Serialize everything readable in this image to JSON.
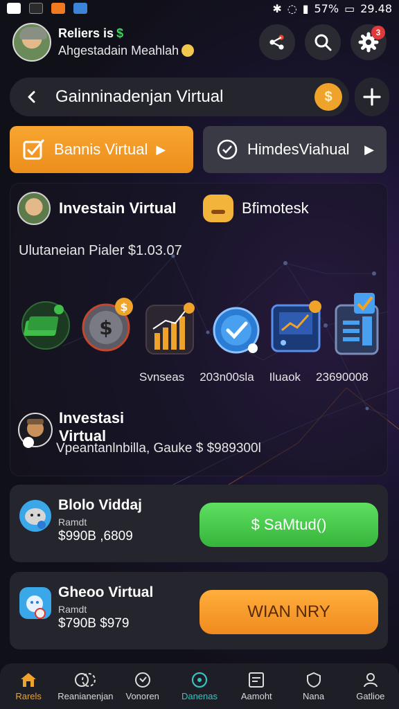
{
  "status_bar": {
    "battery": "57%",
    "time": "29.48"
  },
  "header": {
    "user_name": "Reliers is",
    "user_trend": "$",
    "user_subtitle": "Ahgestadain Meahlah",
    "notification_count": "3"
  },
  "title_bar": {
    "title": "Gainninadenjan Virtual",
    "coin_symbol": "$"
  },
  "modes": {
    "primary_label": "Bannis Virtual",
    "secondary_label": "HimdesViahual"
  },
  "main_card": {
    "investor_label": "Investain Virtual",
    "bonus_label": "Bfimotesk",
    "portfolio_text": "Ulutaneian Pialer $1.03.07",
    "asset_labels": [
      "Svnseas",
      "203n00sla",
      "Iluaok",
      "23690008"
    ],
    "invest_title": "Investasi Virtual",
    "invest_subtitle": "Vpeantanlnbilla, Gauke  $ $989300l"
  },
  "offers": [
    {
      "title": "Blolo Viddaj",
      "meta": "Ramdt",
      "price": "$990B ,6809",
      "button_label": "$ SaMtud()"
    },
    {
      "title": "Gheoo Virtual",
      "meta": "Ramdt",
      "price": "$790B $979",
      "button_label": "WIAN NRY"
    }
  ],
  "bottom_nav": [
    {
      "label": "Rarels",
      "icon": "home-icon"
    },
    {
      "label": "Reanianenjan",
      "icon": "coins-icon"
    },
    {
      "label": "Vonoren",
      "icon": "compass-icon"
    },
    {
      "label": "Danenas",
      "icon": "target-icon"
    },
    {
      "label": "Aamoht",
      "icon": "document-icon"
    },
    {
      "label": "Nana",
      "icon": "shield-icon"
    },
    {
      "label": "Gatlioe",
      "icon": "person-icon"
    }
  ],
  "colors": {
    "accent_orange": "#F0A32A",
    "accent_green": "#3FBF3F",
    "card_bg": "#25252E",
    "teal": "#37C4C0"
  }
}
